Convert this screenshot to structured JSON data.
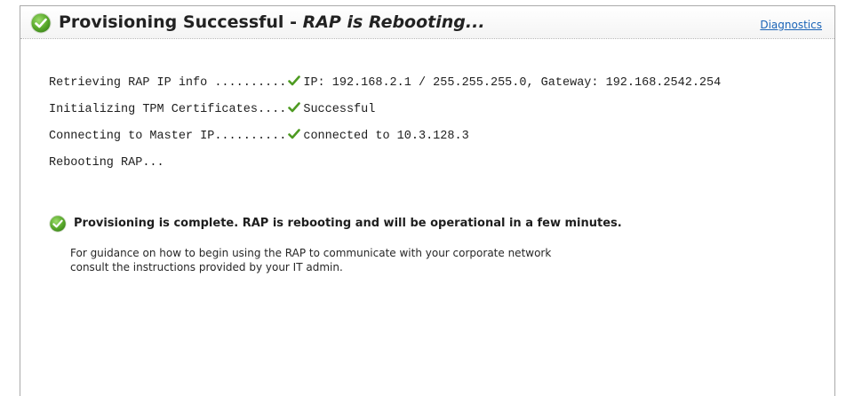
{
  "header": {
    "title_prefix": "Provisioning Successful - ",
    "title_emphasis": "RAP is Rebooting...",
    "diagnostics_link": "Diagnostics"
  },
  "log": [
    {
      "label": "Retrieving RAP IP info ..........",
      "status_icon": "checkmark-icon",
      "result": "IP: 192.168.2.1 / 255.255.255.0, Gateway: 192.168.2542.254"
    },
    {
      "label": "Initializing TPM Certificates....",
      "status_icon": "checkmark-icon",
      "result": "Successful"
    },
    {
      "label": "Connecting to Master IP..........",
      "status_icon": "checkmark-icon",
      "result": "connected to 10.3.128.3"
    },
    {
      "label": "Rebooting RAP...",
      "status_icon": "",
      "result": ""
    }
  ],
  "completion": {
    "message": "Provisioning is complete.  RAP is rebooting and will be operational in a few minutes.",
    "guidance_line1": "For guidance on how to begin using the RAP to communicate with your corporate network",
    "guidance_line2": "consult the instructions provided by your IT admin."
  },
  "colors": {
    "success_green": "#5aa82e",
    "link_blue": "#1a64b7",
    "border_gray": "#a9a9a9"
  }
}
